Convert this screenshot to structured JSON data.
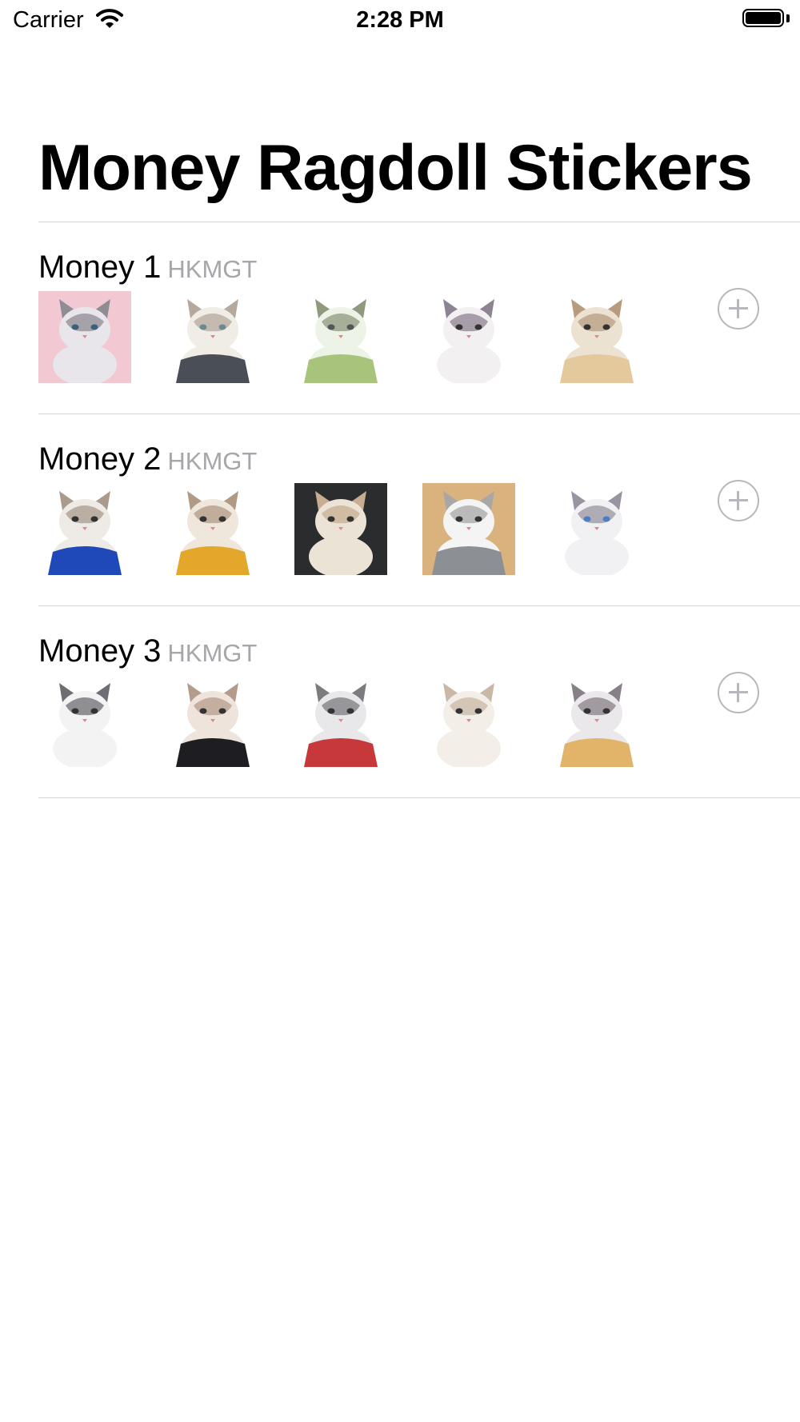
{
  "status_bar": {
    "carrier": "Carrier",
    "time": "2:28 PM"
  },
  "title": "Money Ragdoll Stickers",
  "packs": [
    {
      "name": "Money 1",
      "author": "HKMGT",
      "stickers": [
        {
          "bg": "#f2c9d2",
          "fur": "#e8e6ea",
          "mask": "#8f8c93",
          "eye": "#3c5f7a"
        },
        {
          "bg": "#ffffff",
          "fur": "#f0ece6",
          "mask": "#b5a99d",
          "eye": "#6a8c90",
          "base": "#4a4e56"
        },
        {
          "bg": "#ffffff",
          "fur": "#eef3e8",
          "mask": "#8e9a7e",
          "eye": "#555",
          "base": "#a8c47a"
        },
        {
          "bg": "#ffffff",
          "fur": "#f3f0f2",
          "mask": "#8e8391",
          "eye": "#333"
        },
        {
          "bg": "#ffffff",
          "fur": "#ece2d2",
          "mask": "#b79c80",
          "eye": "#333",
          "base": "#e3c99b"
        }
      ]
    },
    {
      "name": "Money 2",
      "author": "HKMGT",
      "stickers": [
        {
          "bg": "#ffffff",
          "fur": "#eeeae6",
          "mask": "#a99a8c",
          "eye": "#333",
          "base": "#1f49b8"
        },
        {
          "bg": "#ffffff",
          "fur": "#efe6dc",
          "mask": "#b09a85",
          "eye": "#333",
          "base": "#e3a72c"
        },
        {
          "bg": "#2a2c2e",
          "fur": "#ece3d7",
          "mask": "#c7ad92",
          "eye": "#333"
        },
        {
          "bg": "#d9b27e",
          "fur": "#f4f4f4",
          "mask": "#a7a7a7",
          "eye": "#333",
          "base": "#8c8f94"
        },
        {
          "bg": "#ffffff",
          "fur": "#f1f1f3",
          "mask": "#9a94a0",
          "eye": "#4d7ec4"
        }
      ]
    },
    {
      "name": "Money 3",
      "author": "HKMGT",
      "stickers": [
        {
          "bg": "#ffffff",
          "fur": "#f3f3f3",
          "mask": "#6d6d73",
          "eye": "#333"
        },
        {
          "bg": "#ffffff",
          "fur": "#eee4dc",
          "mask": "#b49c8c",
          "eye": "#333",
          "base": "#1e1e22"
        },
        {
          "bg": "#ffffff",
          "fur": "#e8e8ea",
          "mask": "#7b7b80",
          "eye": "#333",
          "base": "#c7383a"
        },
        {
          "bg": "#ffffff",
          "fur": "#f3efe8",
          "mask": "#c9b8a6",
          "eye": "#333"
        },
        {
          "bg": "#ffffff",
          "fur": "#eae8ea",
          "mask": "#888088",
          "eye": "#333",
          "base": "#e1b46a"
        }
      ]
    }
  ]
}
